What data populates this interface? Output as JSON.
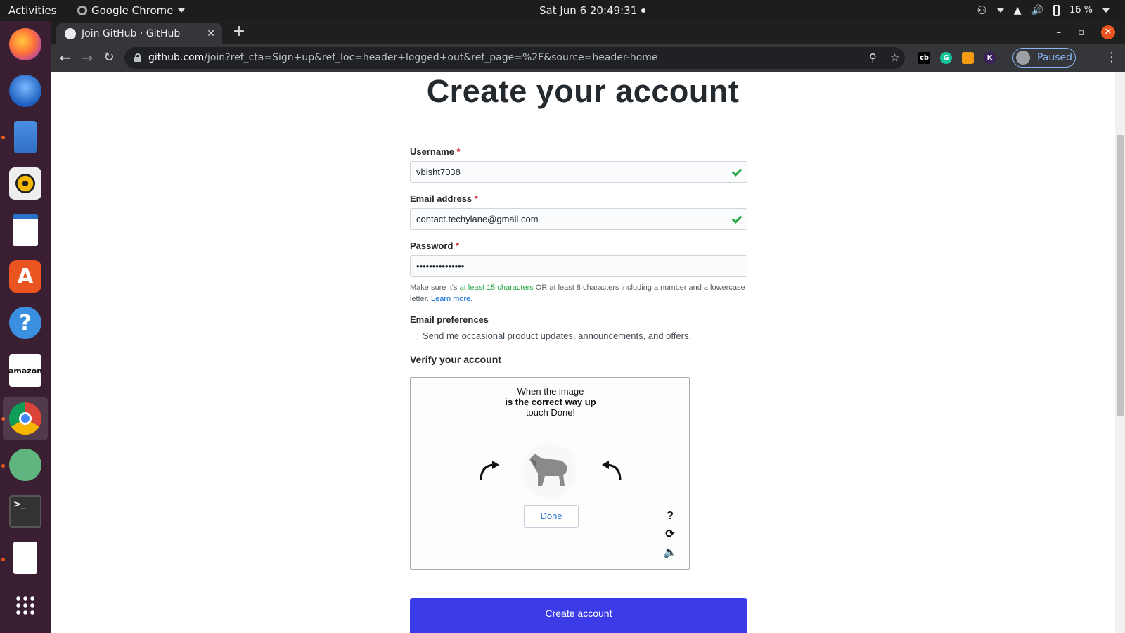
{
  "system_bar": {
    "activities": "Activities",
    "app_name": "Google Chrome",
    "clock": "Sat Jun 6  20:49:31",
    "battery": "16 %"
  },
  "dock": {
    "items": [
      {
        "name": "firefox",
        "label": ""
      },
      {
        "name": "thunderbird",
        "label": ""
      },
      {
        "name": "files",
        "label": ""
      },
      {
        "name": "rhythmbox",
        "label": ""
      },
      {
        "name": "writer",
        "label": ""
      },
      {
        "name": "software",
        "label": "A"
      },
      {
        "name": "help",
        "label": "?"
      },
      {
        "name": "amazon",
        "label": "amazon"
      },
      {
        "name": "chrome",
        "label": ""
      },
      {
        "name": "atom",
        "label": ""
      },
      {
        "name": "terminal",
        "label": ">_"
      },
      {
        "name": "text-editor",
        "label": ""
      },
      {
        "name": "show-apps",
        "label": ""
      }
    ]
  },
  "browser": {
    "tab_title": "Join GitHub · GitHub",
    "url_host": "github.com",
    "url_path": "/join?ref_cta=Sign+up&ref_loc=header+logged+out&ref_page=%2F&source=header-home",
    "profile_label": "Paused"
  },
  "form": {
    "title": "Create your account",
    "username_label": "Username",
    "username_value": "vbisht7038",
    "email_label": "Email address",
    "email_value": "contact.techylane@gmail.com",
    "password_label": "Password",
    "password_value": "•••••••••••••••",
    "required_mark": "*",
    "hint_prefix": "Make sure it's ",
    "hint_green": "at least 15 characters",
    "hint_middle": " OR at least 8 characters including a number and a lowercase letter. ",
    "hint_link": "Learn more.",
    "prefs_label": "Email preferences",
    "prefs_checkbox": "Send me occasional product updates, announcements, and offers.",
    "verify_label": "Verify your account",
    "create_button": "Create account"
  },
  "captcha": {
    "line1": "When the image",
    "line2": "is the correct way up",
    "line3": "touch Done!",
    "done_label": "Done",
    "help_label": "?"
  }
}
